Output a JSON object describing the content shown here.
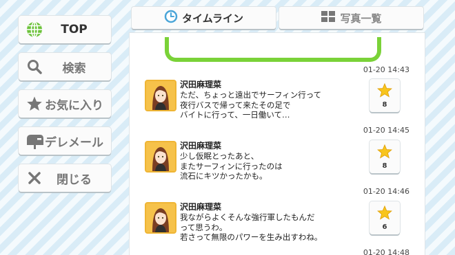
{
  "sidebar": {
    "items": [
      {
        "label": "TOP",
        "icon": "globe-icon"
      },
      {
        "label": "検索",
        "icon": "search-icon"
      },
      {
        "label": "お気に入り",
        "icon": "star-icon"
      },
      {
        "label": "デレメール",
        "icon": "mailbox-icon"
      },
      {
        "label": "閉じる",
        "icon": "close-icon"
      }
    ]
  },
  "tabs": [
    {
      "label": "タイムライン",
      "icon": "clock-icon",
      "active": true
    },
    {
      "label": "写真一覧",
      "icon": "grid-icon",
      "active": false
    }
  ],
  "timeline": {
    "first_timestamp": "01-20 14:43",
    "posts": [
      {
        "name": "沢田麻理菜",
        "text": "ただ、ちょっと遠出でサーフィン行って\n夜行バスで帰って来たその足で\nバイトに行って、一日働いて…",
        "likes": "8",
        "timestamp": "01-20 14:45"
      },
      {
        "name": "沢田麻理菜",
        "text": "少し仮眠とったあと、\nまたサーフィンに行ったのは\n流石にキツかったかも。",
        "likes": "8",
        "timestamp": "01-20 14:46"
      },
      {
        "name": "沢田麻理菜",
        "text": "我ながらよくそんな強行軍したもんだ\nって思うわ。\n若さって無限のパワーを生み出すわね。",
        "likes": "6",
        "timestamp": "01-20 14:48"
      }
    ]
  },
  "colors": {
    "accent_green": "#7ad238",
    "star_yellow": "#f8c51c",
    "tab_clock_blue": "#4aa5d8"
  }
}
